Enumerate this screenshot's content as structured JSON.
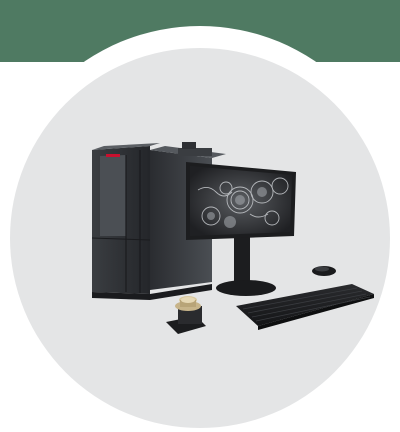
{
  "colors": {
    "band": "#4f7a62",
    "ring": "#ffffff",
    "disc": "#e4e5e6",
    "tower_dark": "#2b2d30",
    "tower_mid": "#45484c",
    "tower_light": "#5d6166",
    "brand_accent": "#c8102e",
    "monitor_frame": "#1c1d1f",
    "keyboard": "#1e1f21"
  },
  "scene": {
    "icons": [
      "sem-microscope-icon",
      "monitor-icon",
      "keyboard-icon",
      "mouse-icon",
      "sample-holder-icon"
    ]
  }
}
